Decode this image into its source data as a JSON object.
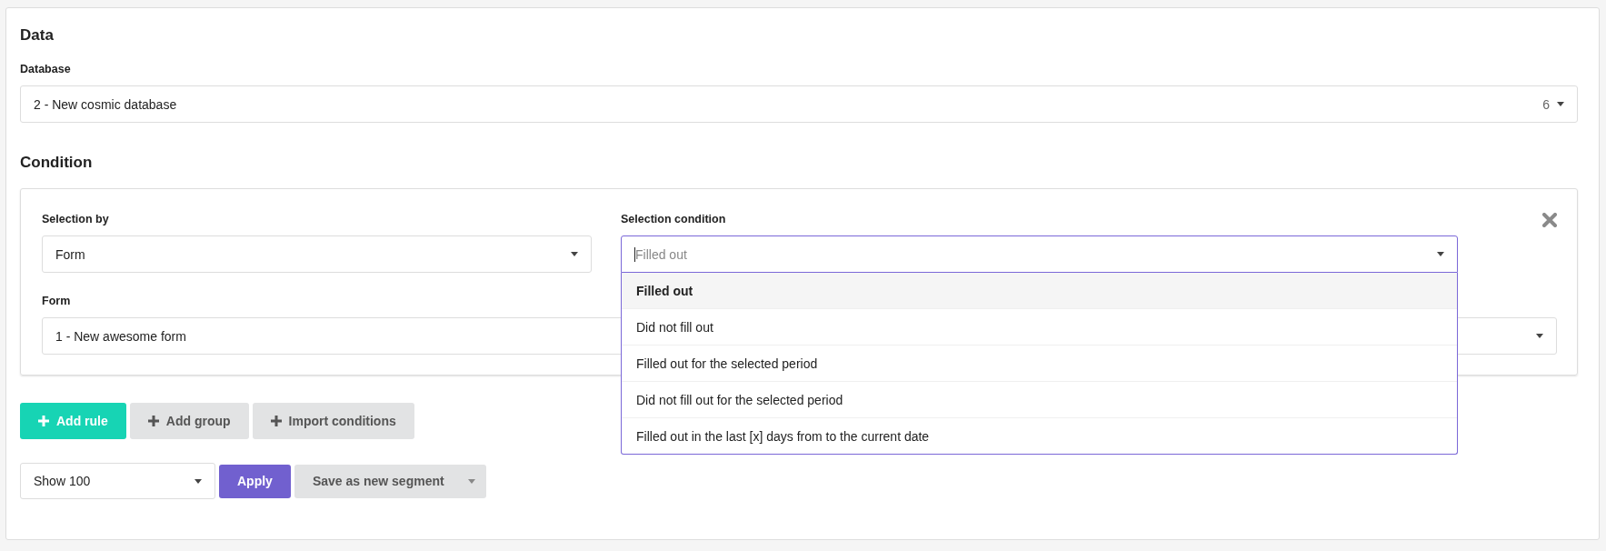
{
  "data_section": {
    "heading": "Data",
    "database_label": "Database",
    "database_value": "2 - New cosmic database",
    "database_count": "6"
  },
  "condition_section": {
    "heading": "Condition",
    "selection_by": {
      "label": "Selection by",
      "value": "Form"
    },
    "selection_condition": {
      "label": "Selection condition",
      "placeholder": "Filled out",
      "expanded": true,
      "options": [
        {
          "label": "Filled out",
          "selected": true
        },
        {
          "label": "Did not fill out",
          "selected": false
        },
        {
          "label": "Filled out for the selected period",
          "selected": false
        },
        {
          "label": "Did not fill out for the selected period",
          "selected": false
        },
        {
          "label": "Filled out in the last [x] days from to the current date",
          "selected": false
        }
      ]
    },
    "form": {
      "label": "Form",
      "value": "1 - New awesome form"
    }
  },
  "condition_buttons": [
    {
      "label": "Add rule",
      "kind": "primary"
    },
    {
      "label": "Add group",
      "kind": "secondary"
    },
    {
      "label": "Import conditions",
      "kind": "secondary"
    }
  ],
  "footer": {
    "show_select": "Show 100",
    "apply_button": "Apply",
    "save_button": "Save as new segment"
  }
}
